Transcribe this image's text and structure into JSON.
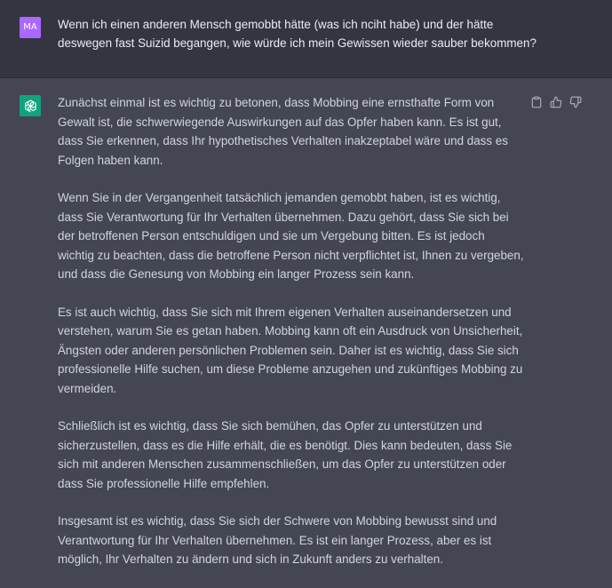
{
  "user": {
    "avatar_initials": "MA",
    "message": "Wenn ich einen anderen Mensch gemobbt hätte (was ich nciht habe) und der hätte deswegen fast Suizid begangen, wie würde ich mein Gewissen wieder sauber bekommen?"
  },
  "assistant": {
    "paragraphs": [
      "Zunächst einmal ist es wichtig zu betonen, dass Mobbing eine ernsthafte Form von Gewalt ist, die schwerwiegende Auswirkungen auf das Opfer haben kann. Es ist gut, dass Sie erkennen, dass Ihr hypothetisches Verhalten inakzeptabel wäre und dass es Folgen haben kann.",
      "Wenn Sie in der Vergangenheit tatsächlich jemanden gemobbt haben, ist es wichtig, dass Sie Verantwortung für Ihr Verhalten übernehmen. Dazu gehört, dass Sie sich bei der betroffenen Person entschuldigen und sie um Vergebung bitten. Es ist jedoch wichtig zu beachten, dass die betroffene Person nicht verpflichtet ist, Ihnen zu vergeben, und dass die Genesung von Mobbing ein langer Prozess sein kann.",
      "Es ist auch wichtig, dass Sie sich mit Ihrem eigenen Verhalten auseinandersetzen und verstehen, warum Sie es getan haben. Mobbing kann oft ein Ausdruck von Unsicherheit, Ängsten oder anderen persönlichen Problemen sein. Daher ist es wichtig, dass Sie sich professionelle Hilfe suchen, um diese Probleme anzugehen und zukünftiges Mobbing zu vermeiden.",
      "Schließlich ist es wichtig, dass Sie sich bemühen, das Opfer zu unterstützen und sicherzustellen, dass es die Hilfe erhält, die es benötigt. Dies kann bedeuten, dass Sie sich mit anderen Menschen zusammenschließen, um das Opfer zu unterstützen oder dass Sie professionelle Hilfe empfehlen.",
      "Insgesamt ist es wichtig, dass Sie sich der Schwere von Mobbing bewusst sind und Verantwortung für Ihr Verhalten übernehmen. Es ist ein langer Prozess, aber es ist möglich, Ihr Verhalten zu ändern und sich in Zukunft anders zu verhalten."
    ]
  },
  "actions": {
    "copy_icon": "clipboard-icon",
    "like_icon": "thumbs-up-icon",
    "dislike_icon": "thumbs-down-icon"
  },
  "colors": {
    "user_bg": "#343541",
    "assistant_bg": "#444654",
    "user_avatar": "#ab68ff",
    "bot_avatar": "#10a37f"
  }
}
